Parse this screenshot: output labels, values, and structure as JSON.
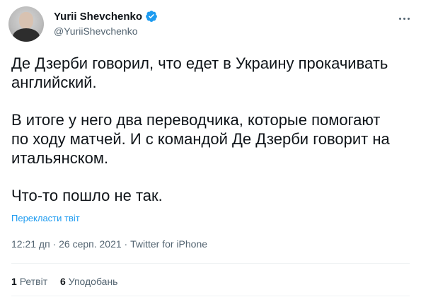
{
  "user": {
    "name": "Yurii Shevchenko",
    "handle": "@YuriiShevchenko",
    "verified_color": "#1d9bf0"
  },
  "tweet": {
    "paragraphs": [
      [
        "Де Дзерби говорил, что едет в Украину прокачивать",
        "английский."
      ],
      [
        "В итоге у него два переводчика, которые помогают",
        "по ходу матчей. И с командой Де Дзерби говорит на",
        "итальянском."
      ],
      [
        "Что-то пошло не так."
      ]
    ],
    "translate_label": "Перекласти твіт",
    "timestamp": "12:21 дп · 26 серп. 2021 · Twitter for iPhone"
  },
  "stats": {
    "retweets_count": "1",
    "retweets_label": "Ретвіт",
    "likes_count": "6",
    "likes_label": "Уподобань"
  },
  "icons": {
    "more": "more-dots-icon",
    "verified": "verified-badge-icon"
  }
}
